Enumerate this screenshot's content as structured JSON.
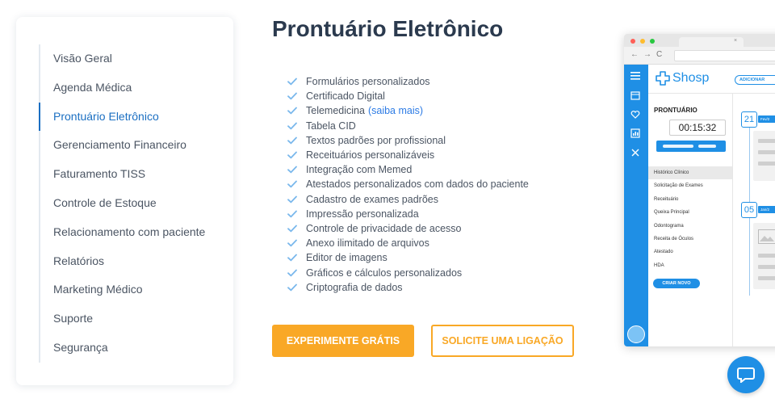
{
  "sidebar": {
    "items": [
      {
        "label": "Visão Geral"
      },
      {
        "label": "Agenda Médica"
      },
      {
        "label": "Prontuário Eletrônico"
      },
      {
        "label": "Gerenciamento Financeiro"
      },
      {
        "label": "Faturamento TISS"
      },
      {
        "label": "Controle de Estoque"
      },
      {
        "label": "Relacionamento com paciente"
      },
      {
        "label": "Relatórios"
      },
      {
        "label": "Marketing Médico"
      },
      {
        "label": "Suporte"
      },
      {
        "label": "Segurança"
      }
    ],
    "active_index": 2
  },
  "main": {
    "title": "Prontuário Eletrônico",
    "features": [
      {
        "text": "Formulários personalizados"
      },
      {
        "text": "Certificado Digital"
      },
      {
        "text": "Telemedicina",
        "link": "(saiba mais)"
      },
      {
        "text": "Tabela CID"
      },
      {
        "text": "Textos padrões por profissional"
      },
      {
        "text": "Receituários personalizáveis"
      },
      {
        "text": "Integração com Memed"
      },
      {
        "text": "Atestados personalizados com dados do paciente"
      },
      {
        "text": "Cadastro de exames padrões"
      },
      {
        "text": "Impressão personalizada"
      },
      {
        "text": "Controle de privacidade de acesso"
      },
      {
        "text": "Anexo ilimitado de arquivos"
      },
      {
        "text": "Editor de imagens"
      },
      {
        "text": "Gráficos e cálculos personalizados"
      },
      {
        "text": "Criptografia de dados"
      }
    ],
    "primary_button": "EXPERIMENTE GRÁTIS",
    "secondary_button": "SOLICITE UMA LIGAÇÃO"
  },
  "mockup": {
    "tab_close": "×",
    "nav_back": "←",
    "nav_forward": "→",
    "nav_reload": "C",
    "logo_text": "Shosp",
    "add_button": "ADICIONAR",
    "panel_title": "PRONTUÁRIO",
    "timer": "00:15:32",
    "menu": [
      "Histórico Clínico",
      "Solicitação de Exames",
      "Receituário",
      "Queixa Principal",
      "Odontograma",
      "Receita de Óculos",
      "Atestado",
      "HDA"
    ],
    "selected_menu_index": 0,
    "new_button": "CRIAR NOVO",
    "entries": [
      {
        "day": "21",
        "tag": "Fev/2"
      },
      {
        "day": "05",
        "tag": "Jan/2"
      }
    ]
  },
  "colors": {
    "accent_blue": "#1b6fc2",
    "brand_blue": "#1f8fe5",
    "orange": "#f9a826",
    "check": "#7ab8ec",
    "title": "#2b3a4e"
  },
  "icons": {
    "check": "check-icon",
    "chat": "chat-bubble-icon",
    "logo": "shosp-cross-logo-icon"
  }
}
